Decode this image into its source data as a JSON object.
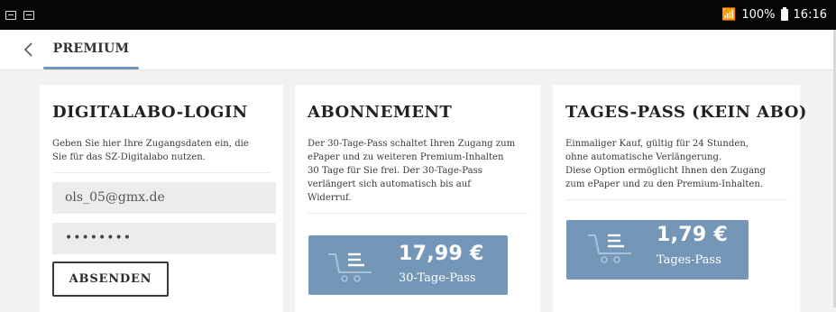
{
  "status_bar": {
    "battery_text": "100%",
    "time": "16:16",
    "icons": [
      "message-icon",
      "screenshot-icon",
      "wifi-icon",
      "battery-icon"
    ]
  },
  "app_bar": {
    "back_icon": "chevron-left-icon",
    "tab_label": "PREMIUM",
    "accent_color": "#6f96b8"
  },
  "login": {
    "title": "DIGITALABO-LOGIN",
    "description": "Geben Sie hier Ihre Zugangsdaten ein, die\nSie für das SZ-Digitalabo nutzen.",
    "email_value": "ols_05@gmx.de",
    "password_value": "••••••••",
    "submit_label": "ABSENDEN"
  },
  "subscription": {
    "title": "ABONNEMENT",
    "description": "Der 30-Tage-Pass schaltet Ihren Zugang zum\nePaper und zu weiteren Premium-Inhalten\n30 Tage für Sie frei. Der 30-Tage-Pass\nverlängert sich automatisch bis auf\nWiderruf.",
    "price": "17,99 €",
    "price_label": "30-Tage-Pass",
    "button_color": "#7496b7",
    "icon": "cart-icon"
  },
  "day_pass": {
    "title": "TAGES-PASS (KEIN ABO)",
    "description": "Einmaliger Kauf, gültig für 24 Stunden,\nohne automatische Verlängerung.\nDiese Option ermöglicht Ihnen den Zugang\nzum ePaper und zu den Premium-Inhalten.",
    "price": "1,79 €",
    "price_label": "Tages-Pass",
    "button_color": "#7496b7",
    "icon": "cart-icon"
  }
}
